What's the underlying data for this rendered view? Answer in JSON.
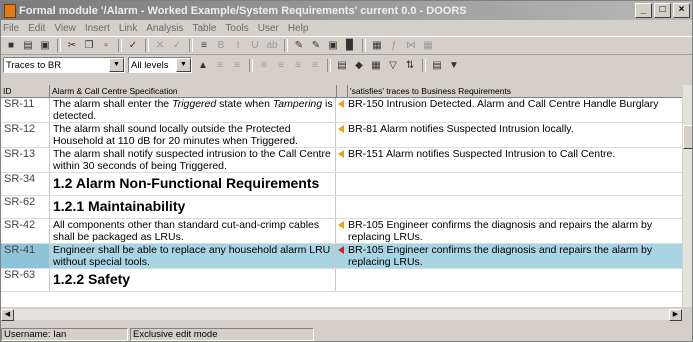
{
  "window": {
    "title": "Formal module '/Alarm - Worked Example/System Requirements' current 0.0 - DOORS",
    "controls": [
      "_",
      "□",
      "×"
    ]
  },
  "menu": [
    "File",
    "Edit",
    "View",
    "Insert",
    "Link",
    "Analysis",
    "Table",
    "Tools",
    "User",
    "Help"
  ],
  "toolbar2": {
    "view_combo": "Traces to BR",
    "level_combo": "All levels"
  },
  "columns": {
    "id": "ID",
    "spec": "Alarm & Call Centre Specification",
    "trace": "'satisfies' traces to Business Requirements"
  },
  "rows": [
    {
      "id": "SR-11",
      "spec": [
        "The alarm shall enter the ",
        "Triggered",
        " state when ",
        "Tampering",
        " is detected."
      ],
      "trace": "BR-150  Intrusion Detected. Alarm and Call Centre Handle Burglary",
      "mark": "orange"
    },
    {
      "id": "SR-12",
      "spec": "The alarm shall sound locally outside the Protected Household at 110 dB for 20 minutes when Triggered.",
      "trace": "BR-81  Alarm notifies Suspected Intrusion locally.",
      "mark": "orange"
    },
    {
      "id": "SR-13",
      "spec": "The alarm shall notify suspected intrusion to the Call Centre within 30 seconds of being Triggered.",
      "trace": "BR-151  Alarm notifies Suspected Intrusion to Call Centre.",
      "mark": "orange"
    },
    {
      "id": "SR-34",
      "heading": "1.2 Alarm Non-Functional Requirements"
    },
    {
      "id": "SR-62",
      "heading": "1.2.1 Maintainability"
    },
    {
      "id": "SR-42",
      "spec": "All components other than standard cut-and-crimp cables shall be packaged as LRUs.",
      "trace": "BR-105  Engineer confirms the diagnosis and repairs the alarm by replacing LRUs.",
      "mark": "orange"
    },
    {
      "id": "SR-41",
      "spec": "Engineer shall be able to replace any household alarm LRU without special tools.",
      "trace": "BR-105  Engineer confirms the diagnosis and repairs the alarm by replacing LRUs.",
      "mark": "red",
      "selected": true
    },
    {
      "id": "SR-63",
      "heading": "1.2.2 Safety"
    }
  ],
  "status": {
    "username": "Username: Ian",
    "mode": "Exclusive edit mode"
  }
}
